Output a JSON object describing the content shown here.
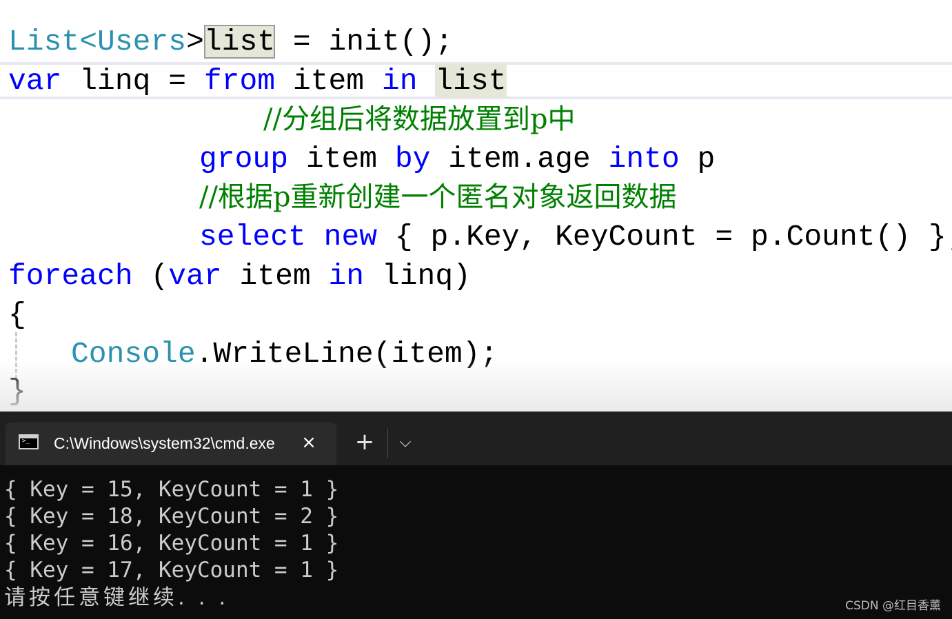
{
  "editor": {
    "lines": [
      {
        "segments": [
          "List<",
          "Users",
          ">",
          "list",
          " = init();"
        ]
      },
      {
        "segments": [
          "var",
          " linq = ",
          "from",
          " item ",
          "in",
          " ",
          "list"
        ]
      },
      {
        "segments": [
          "//分组后将数据放置到p中"
        ]
      },
      {
        "segments": [
          "group",
          " item ",
          "by",
          " item.age ",
          "into",
          " p"
        ]
      },
      {
        "segments": [
          "//根据p重新创建一个匿名对象返回数据"
        ]
      },
      {
        "segments": [
          "select",
          " ",
          "new",
          " { p.Key, KeyCount = p.Count() };"
        ]
      },
      {
        "segments": [
          "foreach",
          " (",
          "var",
          " item ",
          "in",
          " linq)"
        ]
      },
      {
        "segments": [
          "{"
        ]
      },
      {
        "segments": [
          "Console",
          ".WriteLine(item);"
        ]
      },
      {
        "segments": [
          "}"
        ]
      }
    ],
    "colors": {
      "keyword": "#0000ff",
      "type": "#2b91af",
      "comment": "#008000",
      "text": "#000000"
    }
  },
  "terminal": {
    "tab_title": "C:\\Windows\\system32\\cmd.exe",
    "close_icon": "×",
    "new_tab_icon": "+",
    "dropdown_icon": "⌵",
    "output_lines": [
      "{ Key = 15, KeyCount = 1 }",
      "{ Key = 18, KeyCount = 2 }",
      "{ Key = 16, KeyCount = 1 }",
      "{ Key = 17, KeyCount = 1 }"
    ],
    "prompt": "请按任意键继续. . .",
    "background": "#0c0c0c"
  },
  "watermark": "CSDN @红目香薰"
}
